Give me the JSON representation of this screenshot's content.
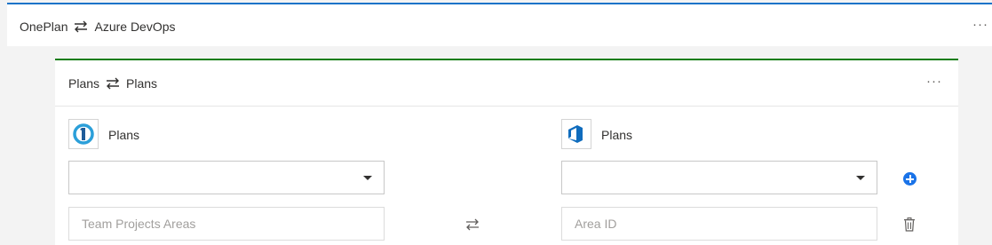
{
  "outer": {
    "left_label": "OnePlan",
    "right_label": "Azure DevOps",
    "more_label": "···"
  },
  "card": {
    "left_label": "Plans",
    "right_label": "Plans",
    "more_label": "···"
  },
  "left_panel": {
    "logo_icon": "oneplan-logo-icon",
    "label": "Plans",
    "select_value": "",
    "field_placeholder": "Team Projects Areas"
  },
  "right_panel": {
    "logo_icon": "azure-devops-logo-icon",
    "label": "Plans",
    "select_value": "",
    "field_placeholder": "Area ID"
  },
  "colors": {
    "outer_accent": "#1a73c8",
    "card_accent": "#107c10",
    "add_button": "#1a73e8"
  }
}
